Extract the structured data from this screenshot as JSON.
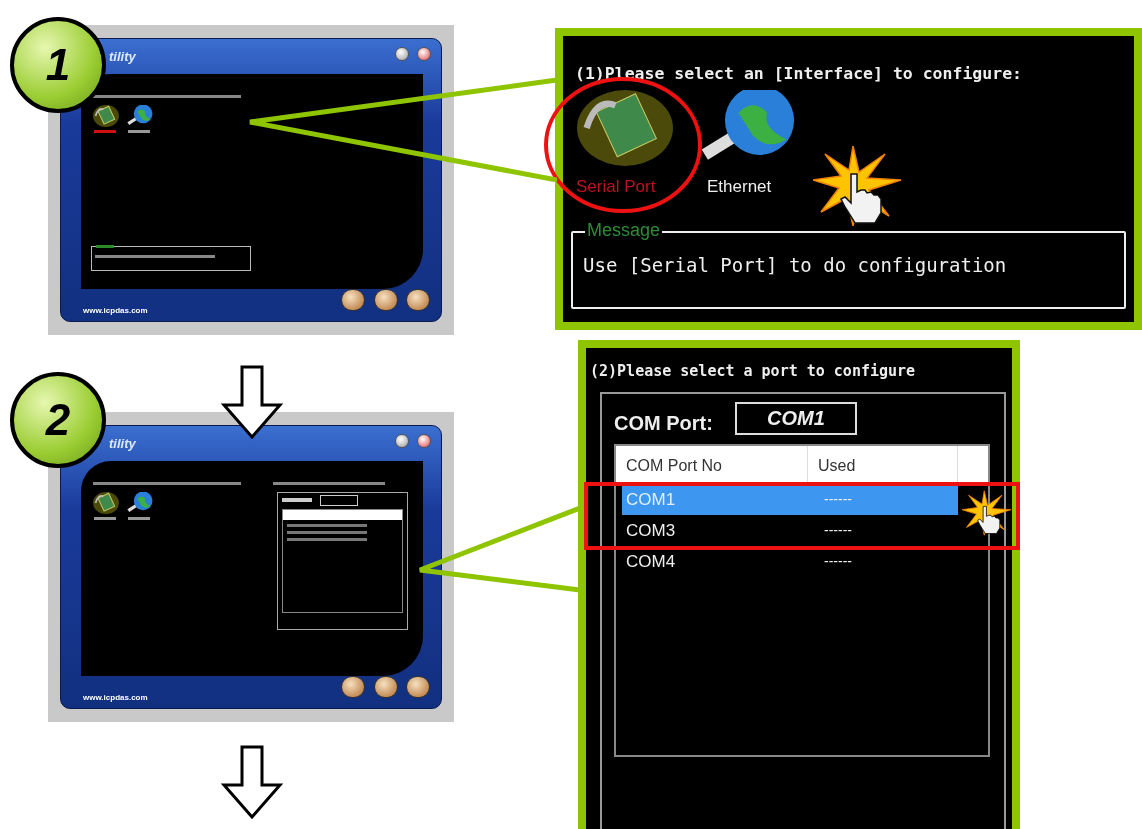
{
  "steps": [
    {
      "number": "1",
      "window": {
        "title": "tility",
        "website": "www.icpdas.com",
        "interfaces": [
          {
            "selected": true
          },
          {
            "selected": false
          }
        ],
        "has_message_box": true,
        "has_port_panel": false
      }
    },
    {
      "number": "2",
      "window": {
        "title": "tility",
        "website": "www.icpdas.com",
        "interfaces": [
          {
            "selected": false
          },
          {
            "selected": false
          }
        ],
        "has_message_box": false,
        "has_port_panel": true
      }
    }
  ],
  "callouts": [
    {
      "kind": "interface",
      "prompt": "(1)Please select an [Interface] to configure:",
      "interfaces": [
        {
          "label": "Serial Port",
          "selected": true
        },
        {
          "label": "Ethernet",
          "selected": false
        }
      ],
      "message": {
        "label": "Message",
        "text": "Use [Serial Port] to do configuration"
      }
    },
    {
      "kind": "port",
      "prompt": "(2)Please select a port to configure",
      "com_port_label": "COM Port:",
      "com_port_value": "COM1",
      "columns": [
        "COM Port No",
        "Used"
      ],
      "rows": [
        {
          "port": "COM1",
          "used": "------",
          "selected": true
        },
        {
          "port": "COM3",
          "used": "------",
          "selected": false
        },
        {
          "port": "COM4",
          "used": "------",
          "selected": false
        }
      ]
    }
  ]
}
